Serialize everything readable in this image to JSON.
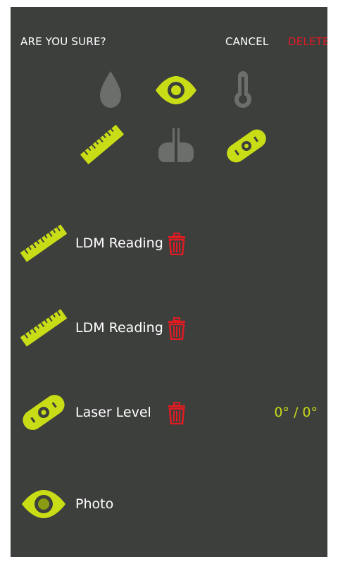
{
  "header": {
    "title": "ARE YOU SURE?",
    "cancel_label": "CANCEL",
    "delete_label": "DELETE"
  },
  "filters": [
    {
      "icon": "water-drop-icon",
      "active": false
    },
    {
      "icon": "eye-icon",
      "active": true
    },
    {
      "icon": "thermometer-icon",
      "active": false
    },
    {
      "icon": "ruler-icon",
      "active": true
    },
    {
      "icon": "cartridge-icon",
      "active": false
    },
    {
      "icon": "laser-level-icon",
      "active": true
    }
  ],
  "readings": [
    {
      "icon": "ruler-icon",
      "label": "LDM Reading",
      "value": ""
    },
    {
      "icon": "ruler-icon",
      "label": "LDM Reading",
      "value": ""
    },
    {
      "icon": "laser-level-icon",
      "label": "Laser Level",
      "value": "0° / 0°"
    },
    {
      "icon": "eye-icon",
      "label": "Photo",
      "value": ""
    }
  ],
  "colors": {
    "background": "#3d3f3d",
    "accent": "#c9dd17",
    "inactive_icon": "#6b6e6b",
    "delete_red": "#e01b22",
    "text": "#ffffff"
  }
}
